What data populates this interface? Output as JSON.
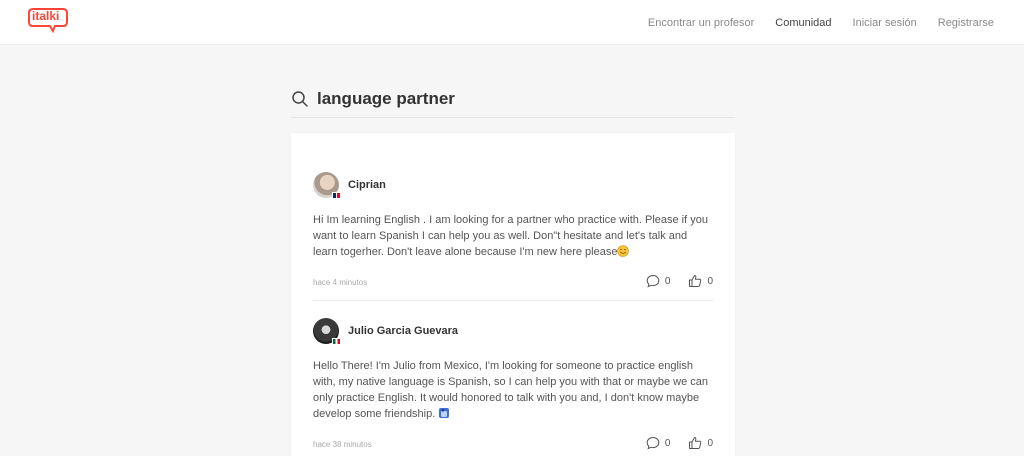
{
  "header": {
    "logo_text": "italki",
    "brand_color": "#ff4438",
    "nav": [
      {
        "label": "Encontrar un profesor",
        "active": false
      },
      {
        "label": "Comunidad",
        "active": true
      },
      {
        "label": "Iniciar sesión",
        "active": false
      },
      {
        "label": "Registrarse",
        "active": false
      }
    ]
  },
  "search": {
    "icon": "search-icon",
    "query": "language partner"
  },
  "posts": [
    {
      "author": "Ciprian",
      "flag": "dominican-republic",
      "body": "Hi Im learning English . I am looking for a partner who practice with. Please if you want to learn Spanish I can help you as well. Don\"t hesitate and let's talk and learn togerher. Don't leave alone because I'm new here please",
      "emoji": "smiling-face-emoji",
      "time": "hace 4 minutos",
      "comments": "0",
      "likes": "0"
    },
    {
      "author": "Julio Garcia Guevara",
      "flag": "mexico",
      "body": "Hello There! I'm Julio from Mexico, I'm looking for someone to practice english with, my native language is Spanish, so I can help you with that or maybe we can only practice English. It would honored to talk with you and, I don't know maybe develop some friendship.",
      "emoji": "blue-sticker-emoji",
      "time": "hace 38 minutos",
      "comments": "0",
      "likes": "0"
    }
  ]
}
